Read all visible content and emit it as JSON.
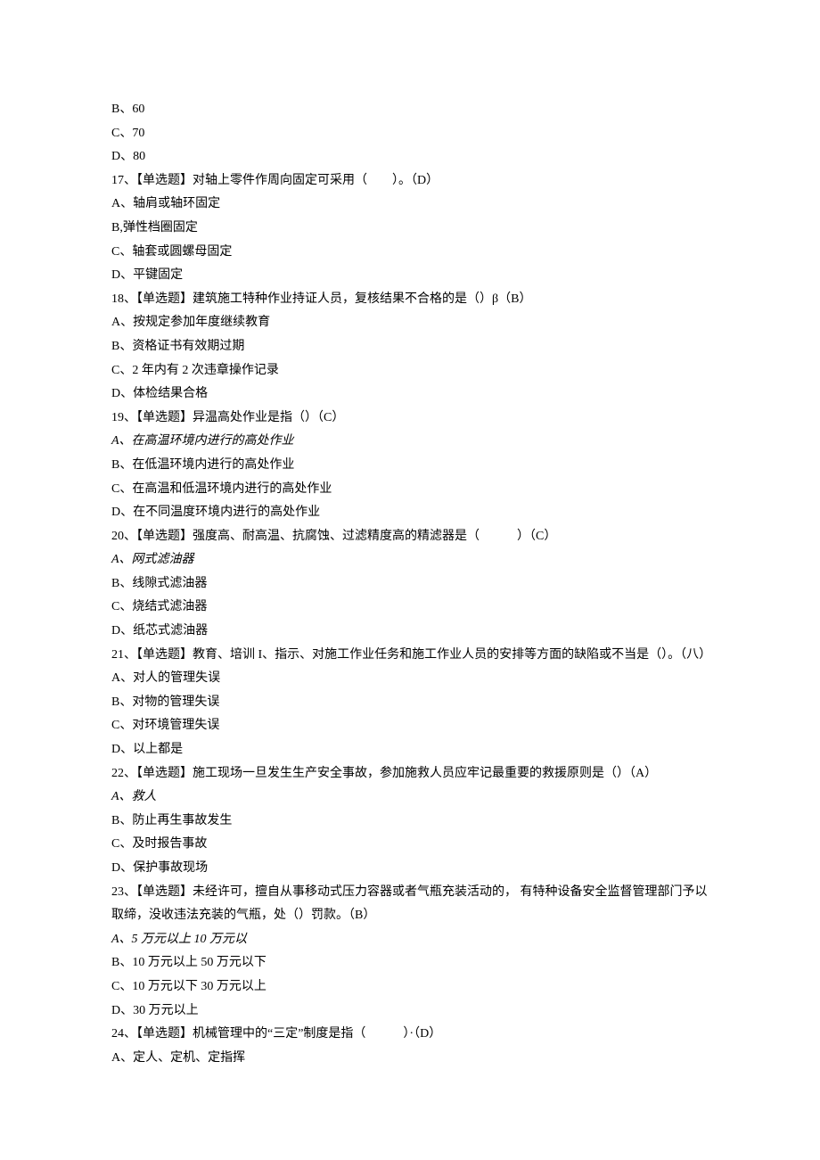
{
  "lines": [
    {
      "text": "B、60"
    },
    {
      "text": "C、70"
    },
    {
      "text": "D、80"
    },
    {
      "text": "17、【单选题】对轴上零件作周向固定可采用（　　）。（D）"
    },
    {
      "text": "A、轴肩或轴环固定"
    },
    {
      "text": "B,弹性档圈固定"
    },
    {
      "text": "C、轴套或圆螺母固定"
    },
    {
      "text": "D、平键固定"
    },
    {
      "text": "18、【单选题】建筑施工特种作业持证人员，复核结果不合格的是（）β（B）"
    },
    {
      "text": "A、按规定参加年度继续教育"
    },
    {
      "text": "B、资格证书有效期过期"
    },
    {
      "text": "C、2 年内有 2 次违章操作记录"
    },
    {
      "text": "D、体检结果合格"
    },
    {
      "text": "19、【单选题】异温高处作业是指（）（C）"
    },
    {
      "text": "A、在高温环境内进行的高处作业",
      "italic": true
    },
    {
      "text": "B、在低温环境内进行的高处作业"
    },
    {
      "text": "C、在高温和低温环境内进行的高处作业"
    },
    {
      "text": "D、在不同温度环境内进行的高处作业"
    },
    {
      "text": "20、【单选题】强度高、耐高温、抗腐蚀、过滤精度高的精滤器是（　　　）（C）"
    },
    {
      "text": "A、网式滤油器",
      "italic": true
    },
    {
      "text": "B、线隙式滤油器"
    },
    {
      "text": "C、烧结式滤油器"
    },
    {
      "text": "D、纸芯式滤油器"
    },
    {
      "text": "21、【单选题】教育、培训 I、指示、对施工作业任务和施工作业人员的安排等方面的缺陷或不当是（）。（八）"
    },
    {
      "text": "A、对人的管理失误"
    },
    {
      "text": "B、对物的管理失误"
    },
    {
      "text": "C、对环境管理失误"
    },
    {
      "text": "D、以上都是"
    },
    {
      "text": "22、【单选题】施工现场一旦发生生产安全事故，参加施救人员应牢记最重要的救援原则是（）（A）"
    },
    {
      "text": "A、救人",
      "italic": true
    },
    {
      "text": "B、防止再生事故发生"
    },
    {
      "text": "C、及时报告事故"
    },
    {
      "text": "D、保护事故现场"
    },
    {
      "text": "23、【单选题】未经许可，擅自从事移动式压力容器或者气瓶充装活动的， 有特种设备安全监督管理部门予以取缔，没收违法充装的气瓶，处（）罚款。（B）"
    },
    {
      "text": "A、5 万元以上 10 万元以",
      "italic": true
    },
    {
      "text": "B、10 万元以上 50 万元以下"
    },
    {
      "text": "C、10 万元以下 30 万元以上"
    },
    {
      "text": "D、30 万元以上"
    },
    {
      "text": "24、【单选题】机械管理中的“三定”制度是指（　　　）·（D）"
    },
    {
      "text": "A、定人、定机、定指挥"
    }
  ]
}
